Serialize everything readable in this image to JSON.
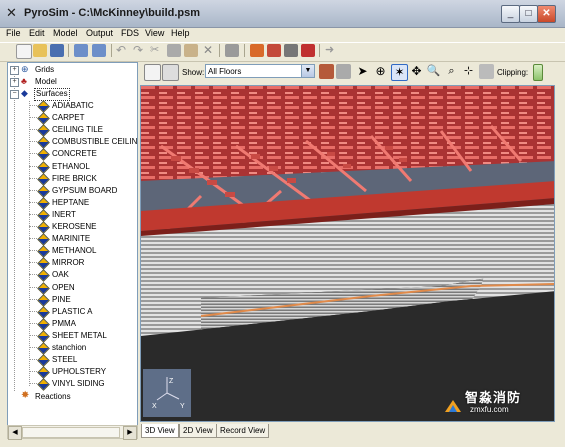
{
  "window": {
    "title": "PyroSim - C:\\McKinney\\build.psm",
    "min": "_",
    "max": "□",
    "close": "✕"
  },
  "menu": [
    "File",
    "Edit",
    "Model",
    "Output",
    "FDS",
    "View",
    "Help"
  ],
  "tree": {
    "grids": "Grids",
    "model": "Model",
    "surfaces": "Surfaces",
    "surface_items": [
      "ADIABATIC",
      "CARPET",
      "CEILING TILE",
      "COMBUSTIBLE CEILING",
      "CONCRETE",
      "ETHANOL",
      "FIRE BRICK",
      "GYPSUM BOARD",
      "HEPTANE",
      "INERT",
      "KEROSENE",
      "MARINITE",
      "METHANOL",
      "MIRROR",
      "OAK",
      "OPEN",
      "PINE",
      "PLASTIC A",
      "PMMA",
      "SHEET METAL",
      "stanchion",
      "STEEL",
      "UPHOLSTERY",
      "VINYL SIDING"
    ],
    "reactions": "Reactions"
  },
  "viewbar": {
    "show_label": "Show:",
    "floor_value": "All Floors",
    "clipping_label": "Clipping:"
  },
  "tabs": [
    "3D View",
    "2D View",
    "Record View"
  ],
  "axes": {
    "x": "X",
    "y": "Y",
    "z": "Z"
  },
  "watermark": {
    "cn": "智淼消防",
    "url": "zmxfu.com"
  },
  "colors": {
    "truss": "#e8706a",
    "truss_dark": "#8a2a2a",
    "seats": "#cfcfcf",
    "floor": "#2f2f2f",
    "accent": "#316ac5"
  }
}
